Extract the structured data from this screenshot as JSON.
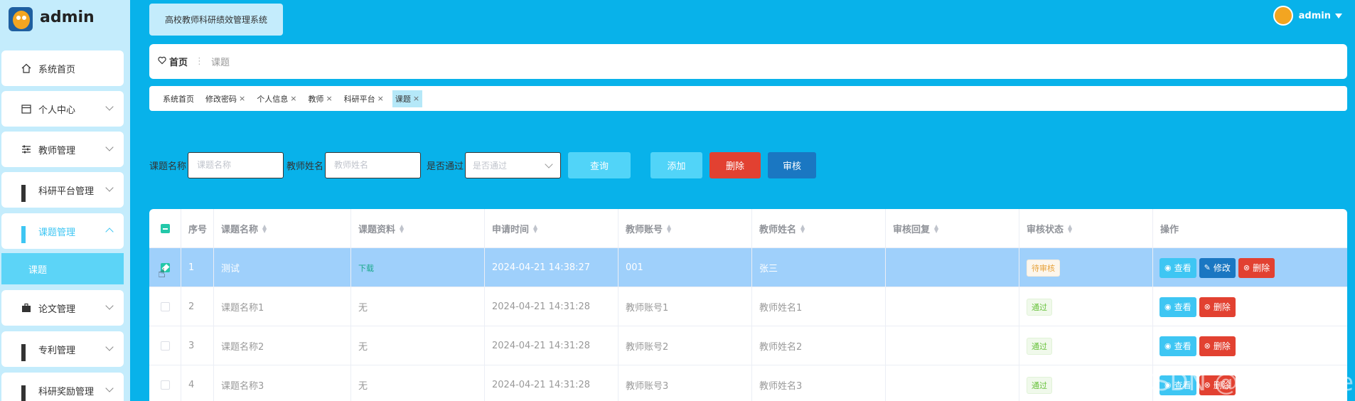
{
  "brand": {
    "name": "admin"
  },
  "sidebar": {
    "items": [
      {
        "label": "系统首页"
      },
      {
        "label": "个人中心"
      },
      {
        "label": "教师管理"
      },
      {
        "label": "科研平台管理"
      },
      {
        "label": "课题管理"
      },
      {
        "label": "论文管理"
      },
      {
        "label": "专利管理"
      },
      {
        "label": "科研奖励管理"
      }
    ],
    "sub_item": "课题"
  },
  "header": {
    "system_title": "高校教师科研绩效管理系统",
    "user_name": "admin"
  },
  "breadcrumb": {
    "home": "首页",
    "current": "课题"
  },
  "tags": [
    {
      "label": "系统首页"
    },
    {
      "label": "修改密码"
    },
    {
      "label": "个人信息"
    },
    {
      "label": "教师"
    },
    {
      "label": "科研平台"
    },
    {
      "label": "课题"
    }
  ],
  "search": {
    "name_label": "课题名称",
    "name_placeholder": "课题名称",
    "teacher_label": "教师姓名",
    "teacher_placeholder": "教师姓名",
    "pass_label": "是否通过",
    "pass_placeholder": "是否通过",
    "query": "查询",
    "add": "添加",
    "delete": "删除",
    "audit": "审核"
  },
  "table": {
    "columns": [
      "序号",
      "课题名称",
      "课题资料",
      "申请时间",
      "教师账号",
      "教师姓名",
      "审核回复",
      "审核状态",
      "操作"
    ],
    "rows": [
      {
        "no": "1",
        "name": "测试",
        "file": "下载",
        "time": "2024-04-21 14:38:27",
        "account": "001",
        "teacher": "张三",
        "reply": "",
        "status": "待审核"
      },
      {
        "no": "2",
        "name": "课题名称1",
        "file": "无",
        "time": "2024-04-21 14:31:28",
        "account": "教师账号1",
        "teacher": "教师姓名1",
        "reply": "",
        "status": "通过"
      },
      {
        "no": "3",
        "name": "课题名称2",
        "file": "无",
        "time": "2024-04-21 14:31:28",
        "account": "教师账号2",
        "teacher": "教师姓名2",
        "reply": "",
        "status": "通过"
      },
      {
        "no": "4",
        "name": "课题名称3",
        "file": "无",
        "time": "2024-04-21 14:31:28",
        "account": "教师账号3",
        "teacher": "教师姓名3",
        "reply": "",
        "status": "通过"
      }
    ],
    "actions": {
      "view": "查看",
      "edit": "修改",
      "delete": "删除"
    }
  },
  "watermark": "CSDN @佩奇-code",
  "colors": {
    "background": "#08b2ea",
    "sidebar": "#c4ecfc",
    "accent": "#3ec6f3",
    "danger": "#e24131",
    "primary": "#1a77c2",
    "selected_row": "#9fd0fb"
  }
}
